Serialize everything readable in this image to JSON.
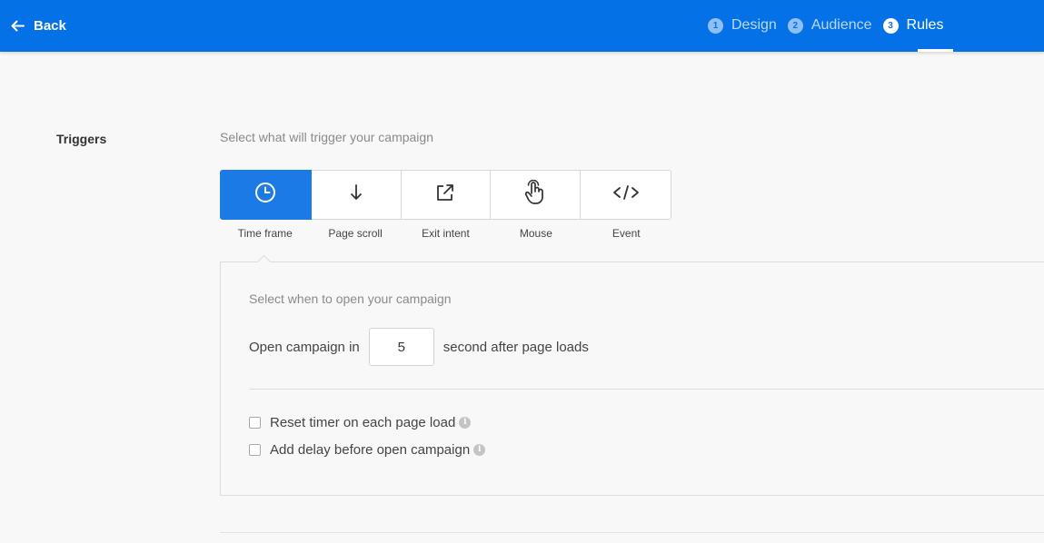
{
  "header": {
    "back_label": "Back",
    "steps": [
      {
        "num": "1",
        "label": "Design",
        "active": false
      },
      {
        "num": "2",
        "label": "Audience",
        "active": false
      },
      {
        "num": "3",
        "label": "Rules",
        "active": true
      }
    ],
    "colors": {
      "bar": "#0571e6",
      "active_tab": "#1b7ae6"
    }
  },
  "triggers": {
    "title": "Triggers",
    "description": "Select what will trigger your campaign",
    "tabs": [
      {
        "label": "Time frame",
        "icon": "clock-icon",
        "selected": true
      },
      {
        "label": "Page scroll",
        "icon": "arrow-down-icon",
        "selected": false
      },
      {
        "label": "Exit intent",
        "icon": "external-link-icon",
        "selected": false
      },
      {
        "label": "Mouse",
        "icon": "pointer-hand-icon",
        "selected": false
      },
      {
        "label": "Event",
        "icon": "code-icon",
        "selected": false
      }
    ]
  },
  "time_frame": {
    "subtitle": "Select when to open your campaign",
    "prefix": "Open campaign in",
    "seconds_value": "5",
    "suffix": "second after page loads",
    "options": [
      {
        "label": "Reset timer on each page load",
        "checked": false
      },
      {
        "label": "Add delay before open campaign",
        "checked": false
      }
    ]
  }
}
